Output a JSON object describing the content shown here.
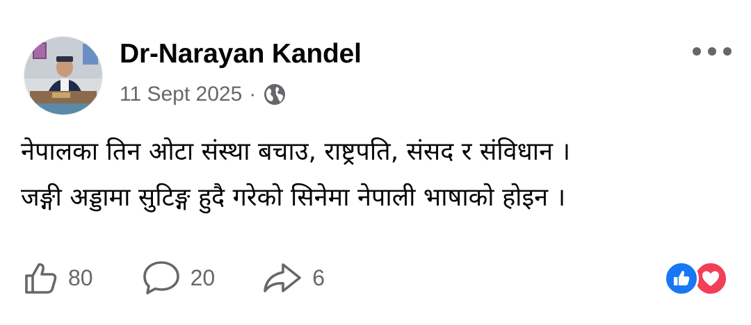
{
  "post": {
    "author": "Dr-Narayan Kandel",
    "date": "11 Sept 2025",
    "separator": "·",
    "audience_icon": "globe-icon",
    "menu_icon": "more-horizontal-icon",
    "text_lines": [
      "नेपालका तिन ओटा संस्था बचाउ, राष्ट्रपति, संसद र संविधान ।",
      "जङ्गी अड्डामा सुटिङ्ग हुदै गरेको सिनेमा नेपाली भाषाको होइन ।"
    ]
  },
  "actions": {
    "like_count": "80",
    "comment_count": "20",
    "share_count": "6"
  },
  "reactions": [
    {
      "type": "like",
      "icon": "like-reaction-icon",
      "color": "#1877f2"
    },
    {
      "type": "love",
      "icon": "love-reaction-icon",
      "color": "#f33e58"
    }
  ],
  "colors": {
    "text": "#050505",
    "secondary": "#65676b",
    "like": "#1877f2",
    "love": "#f33e58"
  }
}
